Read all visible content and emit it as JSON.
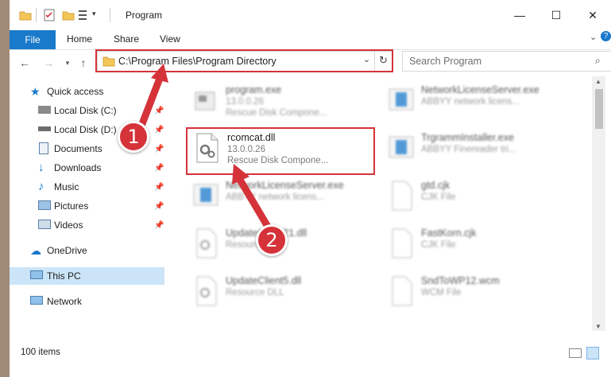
{
  "window": {
    "title": "Program"
  },
  "ribbon": {
    "file": "File",
    "tabs": [
      "Home",
      "Share",
      "View"
    ]
  },
  "address": {
    "path": "C:\\Program Files\\Program Directory"
  },
  "search": {
    "placeholder": "Search Program"
  },
  "nav": {
    "quick_access": "Quick access",
    "items": [
      "Local Disk (C:)",
      "Local Disk (D:)",
      "Documents",
      "Downloads",
      "Music",
      "Pictures",
      "Videos"
    ],
    "onedrive": "OneDrive",
    "this_pc": "This PC",
    "network": "Network"
  },
  "files": [
    {
      "name": "program.exe",
      "l2": "13.0.0.26",
      "l3": "Rescue Disk Compone..."
    },
    {
      "name": "NetworkLicenseServer.exe",
      "l2": "ABBYY network licens...",
      "l3": ""
    },
    {
      "name": "rcomcat.dll",
      "l2": "13.0.0.26",
      "l3": "Rescue Disk Compone..."
    },
    {
      "name": "TrgrammInstaller.exe",
      "l2": "ABBYY Finereader tri...",
      "l3": ""
    },
    {
      "name": "NetworkLicenseServer.exe",
      "l2": "ABBYY network licens...",
      "l3": ""
    },
    {
      "name": "gtd.cjk",
      "l2": "CJK File",
      "l3": ""
    },
    {
      "name": "UpdateClient21.dll",
      "l2": "Resource DLL",
      "l3": ""
    },
    {
      "name": "FastKorn.cjk",
      "l2": "CJK File",
      "l3": ""
    },
    {
      "name": "UpdateClient5.dll",
      "l2": "Resource DLL",
      "l3": ""
    },
    {
      "name": "SndToWP12.wcm",
      "l2": "WCM File",
      "l3": ""
    }
  ],
  "status": {
    "count": "100 items"
  },
  "callouts": [
    "1",
    "2"
  ],
  "colors": {
    "accent": "#1979ca",
    "highlight": "#d5323a",
    "selected": "#cce4f7"
  }
}
